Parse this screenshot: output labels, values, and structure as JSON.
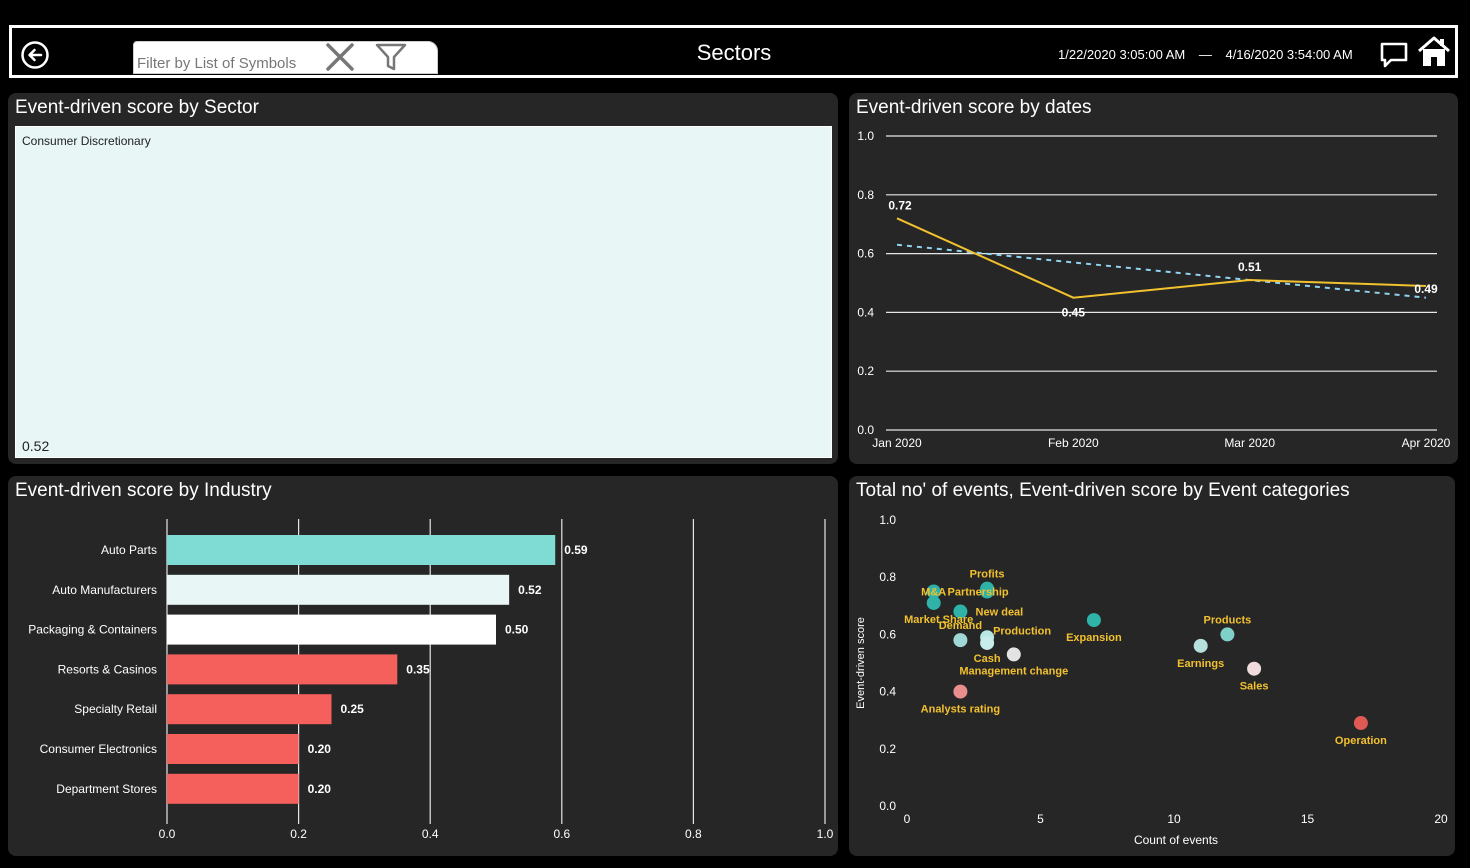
{
  "header": {
    "filter_placeholder": "Filter by List of Symbols",
    "title": "Sectors",
    "date_start": "1/22/2020 3:05:00 AM",
    "date_separator": "—",
    "date_end": "4/16/2020 3:54:00 AM",
    "icons": [
      "back-arrow-icon",
      "close-icon",
      "funnel-icon",
      "comment-icon",
      "home-icon"
    ]
  },
  "panels": {
    "sector_title": "Event-driven score by Sector",
    "dates_title": "Event-driven score by dates",
    "industry_title": "Event-driven score by Industry",
    "events_title": "Total no' of events, Event-driven score by Event categories"
  },
  "colors": {
    "teal": "#7fdcd4",
    "light": "#e8f6f6",
    "white": "#ffffff",
    "red": "#f55f5c",
    "line_yellow": "#f2c12e",
    "trend_blue": "#8fd3f0",
    "panel_bg": "#262626"
  },
  "chart_data": [
    {
      "type": "treemap",
      "tiles": [
        {
          "label": "Consumer Discretionary",
          "value": 0.52,
          "value_label": "0.52"
        }
      ]
    },
    {
      "type": "line",
      "categories": [
        "Jan 2020",
        "Feb 2020",
        "Mar 2020",
        "Apr 2020"
      ],
      "series": [
        {
          "values": [
            0.72,
            0.45,
            0.51,
            0.49
          ],
          "labels": [
            "0.72",
            "0.45",
            "0.51",
            "0.49"
          ]
        }
      ],
      "trendline": {
        "start": 0.63,
        "end": 0.45
      },
      "ylim": [
        0,
        1
      ],
      "yticks": [
        "0.0",
        "0.2",
        "0.4",
        "0.6",
        "0.8",
        "1.0"
      ],
      "grid": true
    },
    {
      "type": "bar",
      "orientation": "horizontal",
      "categories": [
        "Auto Parts",
        "Auto Manufacturers",
        "Packaging & Containers",
        "Resorts & Casinos",
        "Specialty Retail",
        "Consumer Electronics",
        "Department Stores"
      ],
      "values": [
        0.59,
        0.52,
        0.5,
        0.35,
        0.25,
        0.2,
        0.2
      ],
      "value_labels": [
        "0.59",
        "0.52",
        "0.50",
        "0.35",
        "0.25",
        "0.20",
        "0.20"
      ],
      "bar_colors": [
        "#7fdcd4",
        "#e8f6f6",
        "#ffffff",
        "#f55f5c",
        "#f55f5c",
        "#f55f5c",
        "#f55f5c"
      ],
      "xlim": [
        0,
        1
      ],
      "xticks": [
        "0.0",
        "0.2",
        "0.4",
        "0.6",
        "0.8",
        "1.0"
      ],
      "grid": true
    },
    {
      "type": "scatter",
      "xlabel": "Count of events",
      "ylabel": "Event-driven score",
      "xlim": [
        0,
        20
      ],
      "ylim": [
        0,
        1
      ],
      "xticks": [
        "0",
        "5",
        "10",
        "15",
        "20"
      ],
      "yticks": [
        "0.0",
        "0.2",
        "0.4",
        "0.6",
        "0.8",
        "1.0"
      ],
      "points": [
        {
          "label": "M&A",
          "x": 1,
          "y": 0.75,
          "color": "#2fb3a8"
        },
        {
          "label": "Market Share",
          "x": 1,
          "y": 0.71,
          "color": "#2fb3a8"
        },
        {
          "label": "Profits",
          "x": 3,
          "y": 0.76,
          "color": "#2fb3a8"
        },
        {
          "label": "Partnership",
          "x": 3,
          "y": 0.75,
          "color": "#2fb3a8"
        },
        {
          "label": "New deal",
          "x": 2,
          "y": 0.68,
          "color": "#2fb3a8"
        },
        {
          "label": "Demand",
          "x": 2,
          "y": 0.58,
          "color": "#9fd8d4"
        },
        {
          "label": "Production",
          "x": 3,
          "y": 0.59,
          "color": "#b8e6e3"
        },
        {
          "label": "Cash",
          "x": 3,
          "y": 0.57,
          "color": "#c8ecea"
        },
        {
          "label": "Management change",
          "x": 4,
          "y": 0.53,
          "color": "#e3e3e3"
        },
        {
          "label": "Expansion",
          "x": 7,
          "y": 0.65,
          "color": "#2fb3a8"
        },
        {
          "label": "Analysts rating",
          "x": 2,
          "y": 0.4,
          "color": "#e88e8e"
        },
        {
          "label": "Products",
          "x": 12,
          "y": 0.6,
          "color": "#7fd0c8"
        },
        {
          "label": "Earnings",
          "x": 11,
          "y": 0.56,
          "color": "#b6e0dc"
        },
        {
          "label": "Sales",
          "x": 13,
          "y": 0.48,
          "color": "#f0dcdc"
        },
        {
          "label": "Operation",
          "x": 17,
          "y": 0.29,
          "color": "#e05a55"
        }
      ]
    }
  ]
}
